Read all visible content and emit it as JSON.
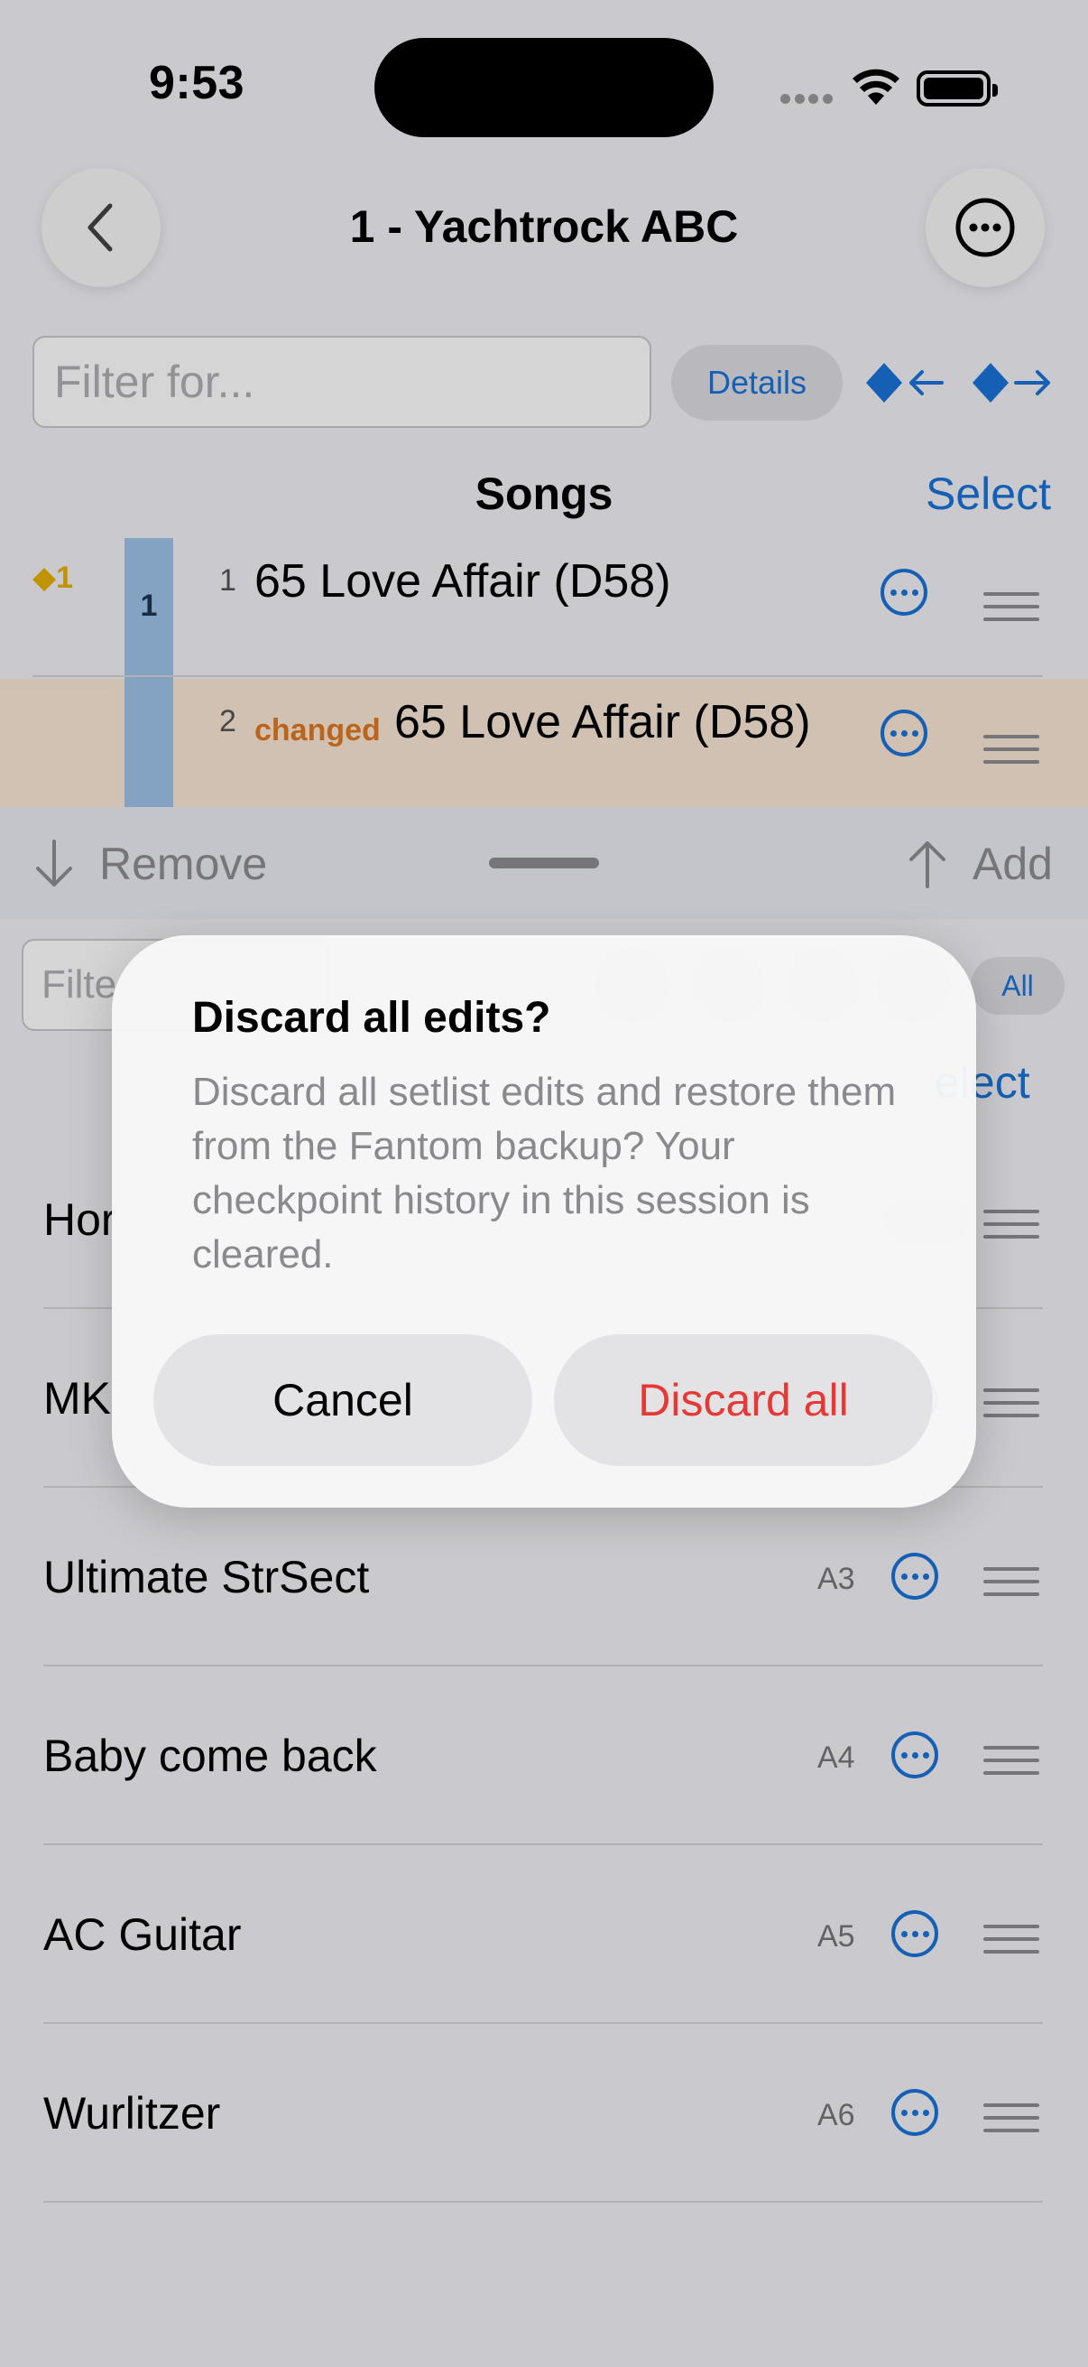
{
  "status_bar": {
    "time": "9:53"
  },
  "nav": {
    "title": "1 - Yachtrock ABC"
  },
  "filter": {
    "placeholder": "Filter for..."
  },
  "details_label": "Details",
  "songs_section": {
    "title": "Songs",
    "select_label": "Select",
    "marker": "◆1",
    "strip_number": "1",
    "rows": [
      {
        "index": "1",
        "name": "65 Love Affair (D58)",
        "status": ""
      },
      {
        "index": "2",
        "name": "65 Love Affair (D58)",
        "status": "changed"
      }
    ]
  },
  "bottom_bar": {
    "remove_label": "Remove",
    "add_label": "Add"
  },
  "library": {
    "filter_placeholder": "Filte",
    "all_label": "All",
    "select_label": "elect",
    "items": [
      {
        "name": "Hor",
        "code": ""
      },
      {
        "name": "MK",
        "code": ""
      },
      {
        "name": "Ultimate StrSect",
        "code": "A3"
      },
      {
        "name": "Baby come back",
        "code": "A4"
      },
      {
        "name": "AC Guitar",
        "code": "A5"
      },
      {
        "name": "Wurlitzer",
        "code": "A6"
      }
    ]
  },
  "alert": {
    "title": "Discard all edits?",
    "message": "Discard all setlist edits and restore them from the Fantom backup? Your checkpoint history in this session is cleared.",
    "cancel_label": "Cancel",
    "discard_label": "Discard all"
  },
  "colors": {
    "accent": "#1a73d9",
    "destructive": "#e53935",
    "changed": "#e07a22",
    "marker": "#e8b000",
    "changed_row_bg": "#fae8d6",
    "strip": "#9fc4ea"
  },
  "icons": [
    "back-chevron-icon",
    "more-ellipsis-icon",
    "wifi-icon",
    "battery-icon",
    "prev-marker-icon",
    "next-marker-icon",
    "ellipsis-circle-icon",
    "drag-handle-icon",
    "arrow-down-icon",
    "arrow-up-icon"
  ]
}
